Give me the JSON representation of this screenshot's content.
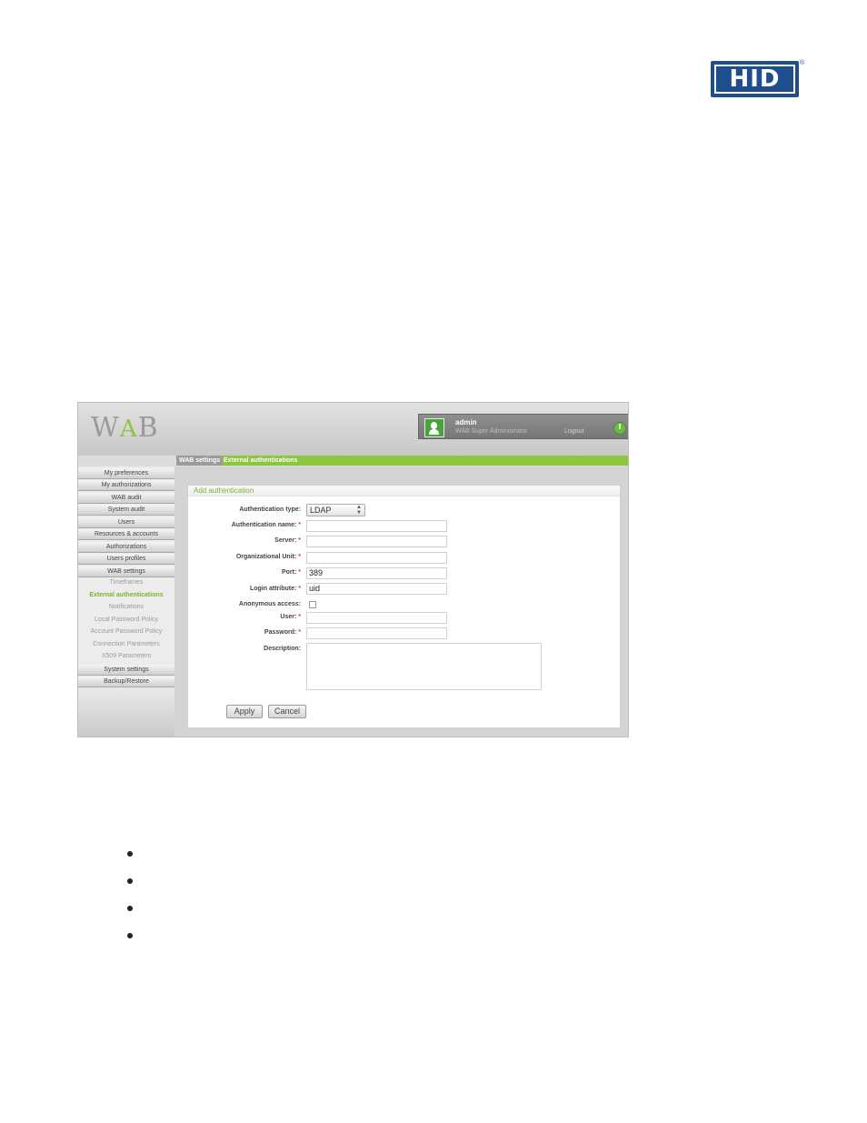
{
  "logo": {
    "text": "HID",
    "reg": "®",
    "color": "#1f4e8c"
  },
  "app": {
    "logo": {
      "w": "W",
      "mid": "A",
      "b": "B"
    },
    "user": {
      "name": "admin",
      "role": "WAB Super Administrator",
      "logout": "Logout"
    },
    "breadcrumb": {
      "parent": "WAB settings",
      "current": "External authentications"
    },
    "sidebar": {
      "items": [
        "My preferences",
        "My authorizations",
        "WAB audit",
        "System audit",
        "Users",
        "Resources & accounts",
        "Authorizations",
        "Users profiles",
        "WAB settings"
      ],
      "subitems": [
        "Timeframes",
        "External authentications",
        "Notifications",
        "Local Password Policy",
        "Account Password Policy",
        "Connection Parameters",
        "X509 Parameters"
      ],
      "bottom_items": [
        "System settings",
        "Backup/Restore"
      ]
    },
    "form": {
      "title": "Add authentication",
      "labels": {
        "auth_type": "Authentication type:",
        "auth_name": "Authentication name:",
        "server": "Server:",
        "org_unit": "Organizational Unit:",
        "port": "Port:",
        "login_attr": "Login attribute:",
        "anonymous": "Anonymous access:",
        "user": "User:",
        "password": "Password:",
        "description": "Description:"
      },
      "required_mark": "*",
      "values": {
        "auth_type": "LDAP",
        "auth_name": "",
        "server": "",
        "org_unit": "",
        "port": "389",
        "login_attr": "uid",
        "user": "",
        "password": "",
        "description": ""
      },
      "anonymous_checked": false,
      "apply_label": "Apply",
      "cancel_label": "Cancel"
    },
    "colors": {
      "accent": "#8cc63f",
      "header": "#c8c8c8"
    }
  },
  "bullets_count": 4
}
